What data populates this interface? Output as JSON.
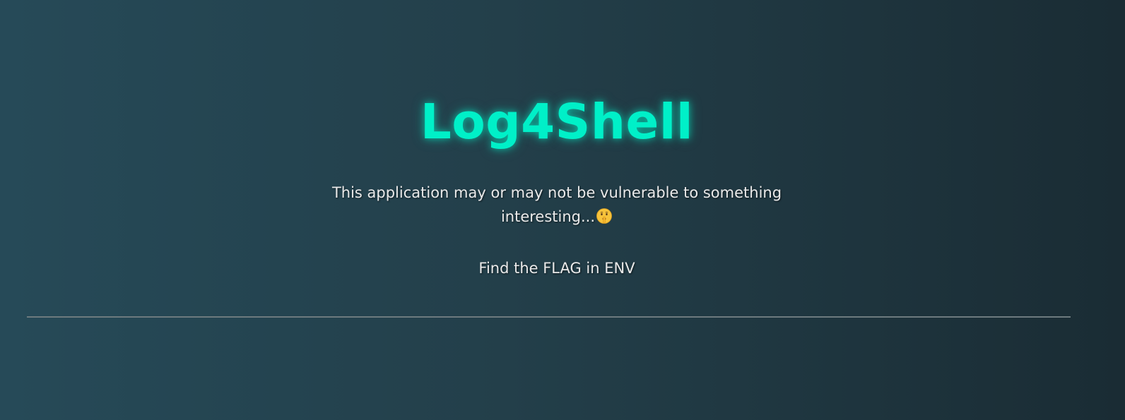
{
  "header": {
    "title": "Log4Shell"
  },
  "main": {
    "description": "This application may or may not be vulnerable to something interesting...",
    "description_icon": "shushing-face-emoji",
    "hint": "Find the FLAG in ENV"
  },
  "colors": {
    "title": "#00f0c8",
    "text": "#eaeaea",
    "background_start": "#264a58",
    "background_end": "#1a2c34",
    "divider": "#6d7a7e"
  }
}
